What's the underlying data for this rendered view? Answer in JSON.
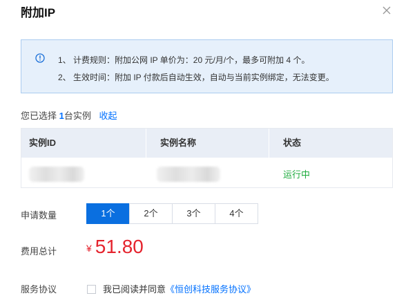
{
  "dialog": {
    "title": "附加IP",
    "close_icon": "close-icon"
  },
  "notice": {
    "icon": "info-icon",
    "line1": "1、 计费规则：附加公网 IP 单价为：20 元/月/个，最多可附加 4 个。",
    "line2": "2、 生效时间：附加 IP 付款后自动生效，自动与当前实例绑定，无法变更。"
  },
  "selection": {
    "prefix": "您已选择 ",
    "count": "1",
    "suffix": "台实例",
    "collapse_label": "收起"
  },
  "table": {
    "headers": [
      "实例ID",
      "实例名称",
      "状态"
    ],
    "rows": [
      {
        "id": "",
        "name": "",
        "status": "运行中"
      }
    ]
  },
  "quantity": {
    "label": "申请数量",
    "options": [
      "1个",
      "2个",
      "3个",
      "4个"
    ],
    "selected": "1个"
  },
  "cost": {
    "label": "费用总计",
    "currency": "¥",
    "amount": "51.80"
  },
  "agreement": {
    "label": "服务协议",
    "text": "我已阅读并同意",
    "link": "《恒创科技服务协议》",
    "checked": false
  },
  "colors": {
    "accent": "#0a6fe0",
    "price": "#e5242e",
    "running": "#1cab3c",
    "notice_bg": "#e6f0fb"
  }
}
